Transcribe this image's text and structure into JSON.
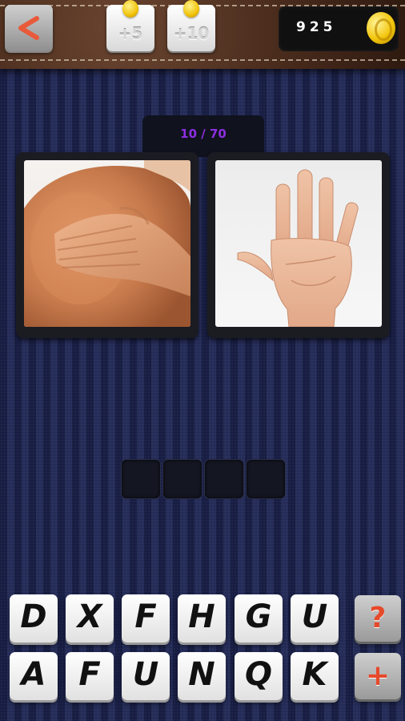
{
  "header": {
    "hints": [
      {
        "label": "+5"
      },
      {
        "label": "+10"
      }
    ],
    "coins": "925"
  },
  "level": {
    "text": "10 / 70"
  },
  "pictures": [
    {
      "subject": "hand-on-shoulder"
    },
    {
      "subject": "open-palm"
    }
  ],
  "answer": {
    "slots": [
      "",
      "",
      "",
      ""
    ]
  },
  "keyboard": {
    "row1": [
      "D",
      "X",
      "F",
      "H",
      "G",
      "U"
    ],
    "row2": [
      "A",
      "F",
      "U",
      "N",
      "Q",
      "K"
    ]
  },
  "side_buttons": {
    "hint_glyph": "?",
    "add_glyph": "+"
  },
  "colors": {
    "level_text": "#8c2fe0",
    "accent_red": "#e64a2c",
    "coin_gold": "#f3c60d"
  }
}
